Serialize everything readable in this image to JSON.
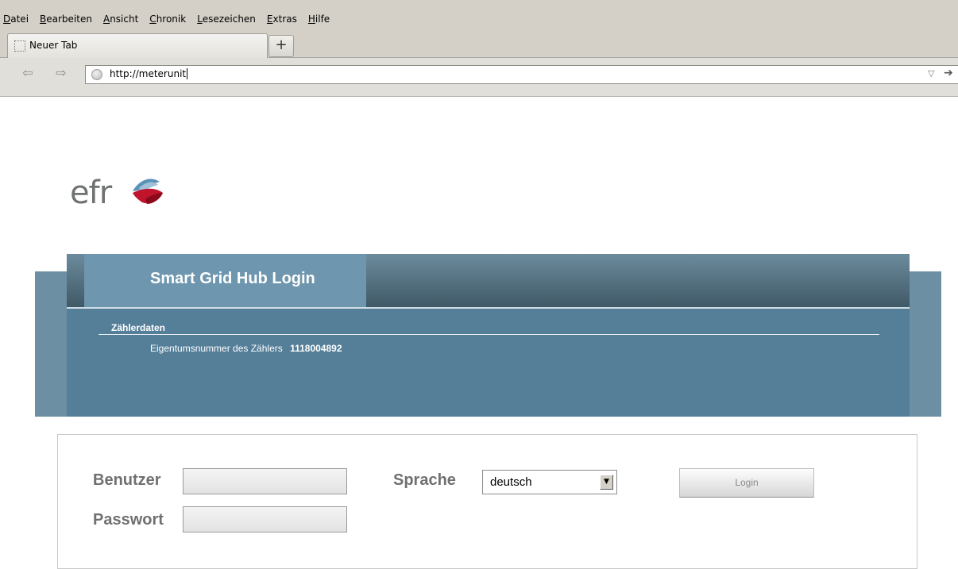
{
  "browser": {
    "menu": [
      "Datei",
      "Bearbeiten",
      "Ansicht",
      "Chronik",
      "Lesezeichen",
      "Extras",
      "Hilfe"
    ],
    "tab_label": "Neuer Tab",
    "newtab_label": "+",
    "back_glyph": "⇦",
    "forward_glyph": "⇨",
    "url": "http://meterunit",
    "url_dropdown_glyph": "▽",
    "go_glyph": "➔"
  },
  "logo": {
    "text": "efr",
    "colors": {
      "red": "#c0142c",
      "blue": "#4f8ab0",
      "gray": "#6f7272"
    }
  },
  "banner": {
    "title": "Smart Grid Hub Login",
    "section_heading": "Zählerdaten",
    "meter_label": "Eigentumsnummer des Zählers",
    "meter_value": "1118004892"
  },
  "login": {
    "user_label": "Benutzer",
    "user_value": "",
    "password_label": "Passwort",
    "password_value": "",
    "language_label": "Sprache",
    "language_value": "deutsch",
    "dropdown_arrow": "▼",
    "button_label": "Login"
  },
  "colors": {
    "banner_blue": "#557f99",
    "banner_light": "#6e96ae",
    "chrome_gray": "#d4d0c8"
  }
}
